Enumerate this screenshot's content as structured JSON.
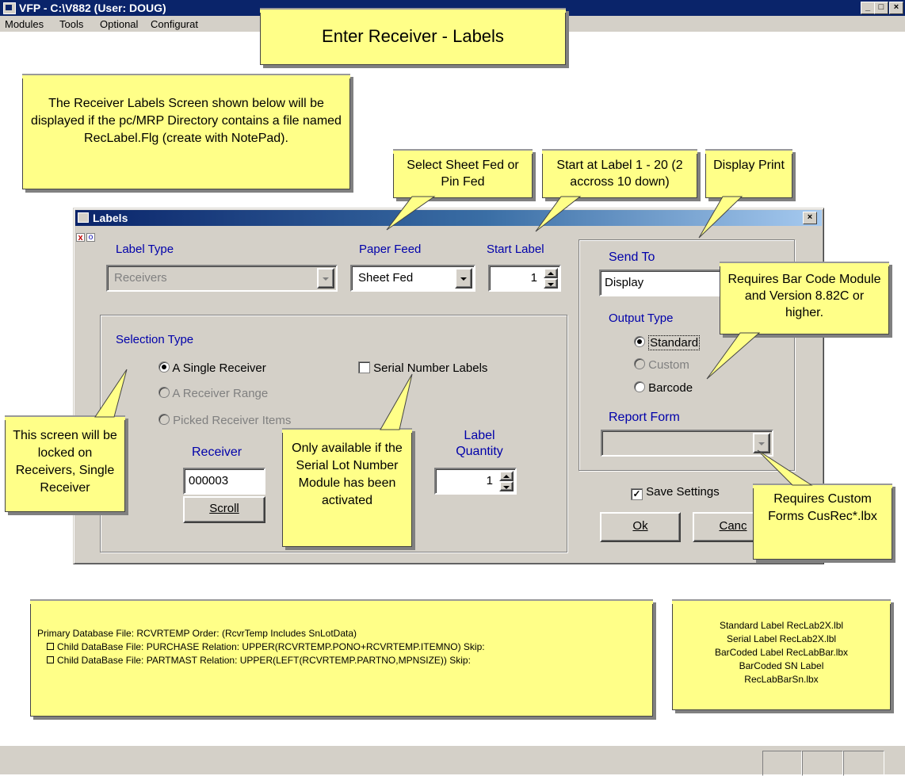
{
  "window": {
    "title": "VFP - C:\\V882  (User: DOUG)",
    "minimize": "_",
    "maximize": "□",
    "close": "×"
  },
  "menu": [
    "Modules",
    "Tools",
    "Optional",
    "Configurat"
  ],
  "callouts": {
    "heading": "Enter Receiver - Labels",
    "intro": "The Receiver Labels Screen shown below will be displayed if the pc/MRP Directory contains a file named RecLabel.Flg (create with NotePad).",
    "paper_feed": "Select Sheet Fed or Pin Fed",
    "start_label": "Start at Label 1 - 20 (2 accross 10 down)",
    "send_to": "Display Print",
    "barcode": "Requires Bar Code Module and Version 8.82C or higher.",
    "locked": "This screen will be locked on Receivers, Single Receiver",
    "serial": "Only available if the Serial Lot Number Module has been activated",
    "custom_forms": "Requires Custom Forms CusRec*.lbx",
    "database": {
      "primary": "Primary Database File: RCVRTEMP Order: (RcvrTemp Includes SnLotData)",
      "child1": "Child DataBase File: PURCHASE Relation: UPPER(RCVRTEMP.PONO+RCVRTEMP.ITEMNO) Skip:",
      "child2": "Child DataBase File: PARTMAST Relation: UPPER(LEFT(RCVRTEMP.PARTNO,MPNSIZE)) Skip:"
    },
    "label_files": [
      "Standard Label RecLab2X.lbl",
      "Serial Label RecLab2X.lbl",
      "BarCoded Label RecLabBar.lbx",
      "BarCoded SN Label",
      "RecLabBarSn.lbx"
    ]
  },
  "dialog": {
    "title": "Labels",
    "close": "×",
    "label_type": {
      "label": "Label Type",
      "value": "Receivers"
    },
    "paper_feed": {
      "label": "Paper Feed",
      "value": "Sheet Fed"
    },
    "start_label": {
      "label": "Start Label",
      "value": "1"
    },
    "selection": {
      "label": "Selection Type",
      "options": [
        "A Single Receiver",
        "A Receiver Range",
        "Picked Receiver Items"
      ],
      "selected": "A Single Receiver"
    },
    "serial_labels": {
      "label": "Serial Number Labels",
      "checked": false
    },
    "receiver": {
      "label": "Receiver",
      "value": "000003",
      "scroll": "Scroll"
    },
    "label_quantity": {
      "label_line1": "Label",
      "label_line2": "Quantity",
      "value": "1"
    },
    "send_to": {
      "label": "Send To",
      "value": "Display"
    },
    "output_type": {
      "label": "Output Type",
      "options": [
        "Standard",
        "Custom",
        "Barcode"
      ],
      "selected": "Standard"
    },
    "report_form": {
      "label": "Report Form",
      "value": ""
    },
    "save_settings": {
      "label": "Save Settings",
      "checked": true,
      "mark": "✓"
    },
    "ok": "Ok",
    "cancel": "Canc"
  }
}
